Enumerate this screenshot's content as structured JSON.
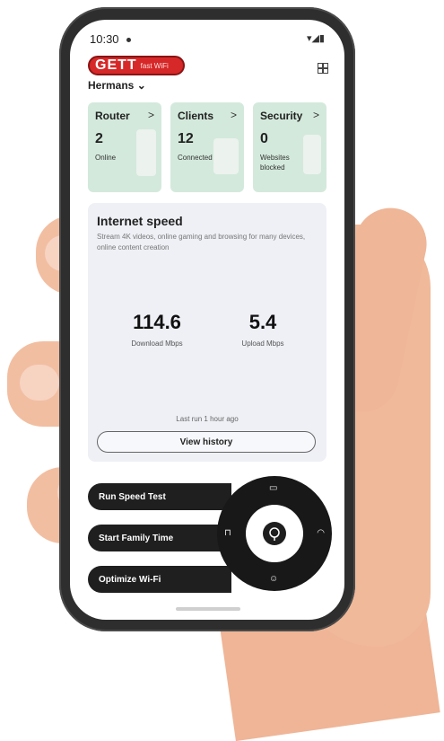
{
  "status": {
    "time": "10:30",
    "icons": "▾◢▮"
  },
  "logo": {
    "main": "GETT",
    "sub": "fast WiFi"
  },
  "network": {
    "name": "Hermans",
    "chevron": "⌄"
  },
  "cards": [
    {
      "title": "Router",
      "value": "2",
      "sub": "Online",
      "arrow": ">"
    },
    {
      "title": "Clients",
      "value": "12",
      "sub": "Connected",
      "arrow": ">"
    },
    {
      "title": "Security",
      "value": "0",
      "sub": "Websites blocked",
      "arrow": ">"
    }
  ],
  "speed": {
    "title": "Internet speed",
    "description": "Stream 4K videos, online gaming and browsing for many devices, online content creation",
    "download_value": "114.6",
    "download_label": "Download Mbps",
    "upload_value": "5.4",
    "upload_label": "Upload Mbps",
    "last_run": "Last run 1 hour ago",
    "history_button": "View history"
  },
  "actions": [
    {
      "label": "Run Speed Test"
    },
    {
      "label": "Start Family Time"
    },
    {
      "label": "Optimize Wi-Fi"
    }
  ],
  "wheel_icons": [
    "tv-icon",
    "wifi-icon",
    "person-icon",
    "router-icon",
    "center-icon"
  ]
}
